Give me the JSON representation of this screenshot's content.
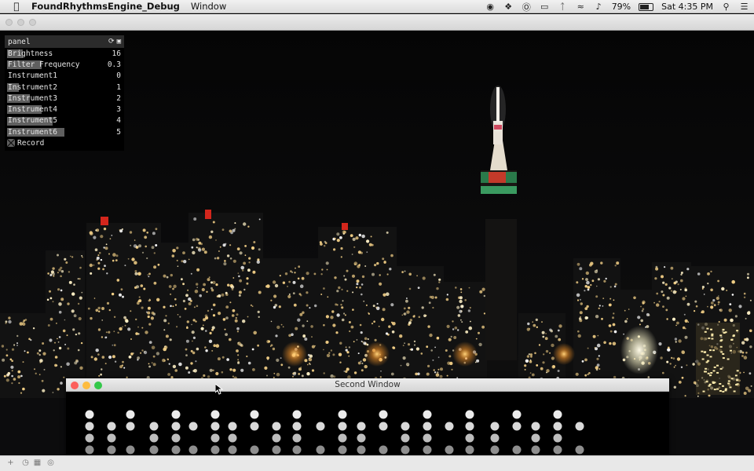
{
  "menubar": {
    "app_name": "FoundRhythmsEngine_Debug",
    "menus": [
      "Window"
    ],
    "battery_percent": "79%",
    "battery_level": 0.79,
    "clock": "Sat 4:35 PM",
    "status_icons": [
      "record-icon",
      "dropbox-icon",
      "onepassword-icon",
      "airplay-icon",
      "bluetooth-icon",
      "wifi-icon",
      "volume-icon",
      "spotlight-icon",
      "notification-center-icon"
    ]
  },
  "panel": {
    "title": "panel",
    "rows": [
      {
        "label": "Brightness",
        "value": "16",
        "fill": 0.14
      },
      {
        "label": "Filter Frequency",
        "value": "0.3",
        "fill": 0.3
      },
      {
        "label": "Instrument1",
        "value": "0",
        "fill": 0
      },
      {
        "label": "Instrument2",
        "value": "1",
        "fill": 0.1
      },
      {
        "label": "Instrument3",
        "value": "2",
        "fill": 0.2
      },
      {
        "label": "Instrument4",
        "value": "3",
        "fill": 0.3
      },
      {
        "label": "Instrument5",
        "value": "4",
        "fill": 0.4
      },
      {
        "label": "Instrument6",
        "value": "5",
        "fill": 0.5
      }
    ],
    "toggle": {
      "label": "Record",
      "checked": true
    }
  },
  "second_window": {
    "title": "Second Window"
  },
  "colors": {
    "panel_bar": "#5f5f5f",
    "traffic_close": "#fc605c",
    "traffic_min": "#fdbc40",
    "traffic_max": "#34c84a"
  }
}
